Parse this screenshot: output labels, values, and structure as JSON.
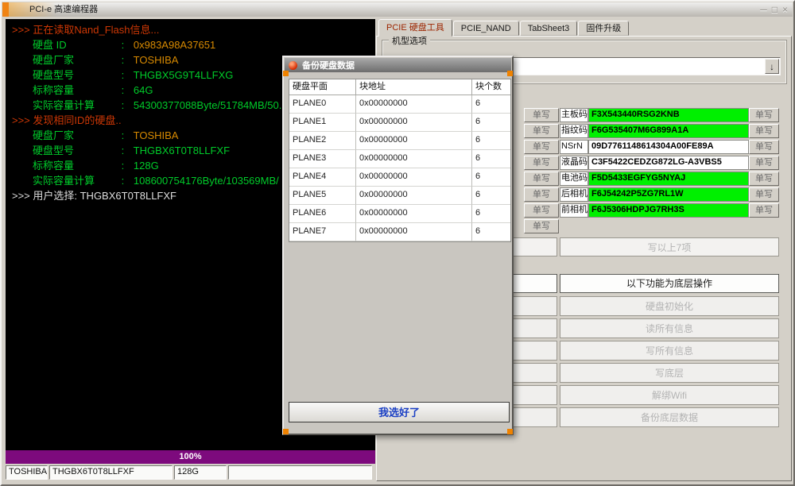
{
  "window": {
    "title": "PCI-e 高速编程器",
    "controls": {
      "minimize": "─",
      "maximize": "□",
      "close": "×"
    }
  },
  "colors": {
    "accent_orange": "#ef8200",
    "value_green": "#00f000",
    "progress_purple": "#7d0a7d"
  },
  "terminal": {
    "lines": [
      {
        "raw": ">>> 正在读取Nand_Flash信息...",
        "rawc": "t-red"
      },
      {
        "label": "硬盘 ID",
        "sep": ":",
        "value": "0x983A98A37651",
        "vc": "t-orange"
      },
      {
        "label": "硬盘厂家",
        "sep": ":",
        "value": "TOSHIBA",
        "vc": "t-orange"
      },
      {
        "label": "硬盘型号",
        "sep": ":",
        "value": "THGBX5G9T4LLFXG",
        "vc": "t-green"
      },
      {
        "label": "标称容量",
        "sep": ":",
        "value": "64G",
        "vc": "t-green"
      },
      {
        "label": "实际容量计算",
        "sep": ":",
        "value": "54300377088Byte/51784MB/50.",
        "vc": "t-green"
      },
      {
        "raw": ">>> 发现相同ID的硬盘..",
        "rawc": "t-red"
      },
      {
        "label": "硬盘厂家",
        "sep": ":",
        "value": "TOSHIBA",
        "vc": "t-orange"
      },
      {
        "label": "硬盘型号",
        "sep": ":",
        "value": "THGBX6T0T8LLFXF",
        "vc": "t-green"
      },
      {
        "label": "标称容量",
        "sep": ":",
        "value": "128G",
        "vc": "t-green"
      },
      {
        "label": "实际容量计算",
        "sep": ":",
        "value": "108600754176Byte/103569MB/",
        "vc": "t-green"
      },
      {
        "raw": ">>> 用户选择: THGBX6T0T8LLFXF",
        "rawc": "t-white"
      }
    ],
    "progress_text": "100%",
    "status_cells": [
      "TOSHIBA",
      "THGBX6T0T8LLFXF",
      "128G",
      ""
    ]
  },
  "tabs": [
    {
      "label": "PCIE 硬盘工具",
      "cls": "active"
    },
    {
      "label": "PCIE_NAND",
      "cls": ""
    },
    {
      "label": "TabSheet3",
      "cls": ""
    },
    {
      "label": "固件升级",
      "cls": ""
    }
  ],
  "model_group": {
    "title": "机型选项",
    "combo_value": "",
    "combo_arrow": "↓"
  },
  "fields": {
    "left_write_buttons": [
      "单写",
      "单写",
      "单写",
      "单写",
      "单写",
      "单写",
      "单写",
      "单写"
    ],
    "rows": [
      {
        "label": "主板码",
        "value": "F3X543440RSG2KNB",
        "vcls": "val-green",
        "btn": "单写"
      },
      {
        "label": "指纹码",
        "value": "F6G535407M6G899A1A",
        "vcls": "val-green",
        "btn": "单写"
      },
      {
        "label": "NSrN",
        "value": "09D7761148614304A00FE89A",
        "vcls": "",
        "btn": "单写"
      },
      {
        "label": "液晶码",
        "value": "C3F5422CEDZG872LG-A3VBS5",
        "vcls": "",
        "btn": "单写"
      },
      {
        "label": "电池码",
        "value": "F5D5433EGFYG5NYAJ",
        "vcls": "val-green",
        "btn": "单写"
      },
      {
        "label": "后相机",
        "value": "F6J54242P5ZG7RL1W",
        "vcls": "val-green",
        "btn": "单写"
      },
      {
        "label": "前相机",
        "value": "F6J5306HDPJG7RH3S",
        "vcls": "val-green",
        "btn": "单写"
      }
    ],
    "write_all_label": "写以上7项"
  },
  "lower_section": {
    "header": "以下功能为底层操作",
    "buttons": [
      "硬盘初始化",
      "读所有信息",
      "写所有信息",
      "写底层",
      "解绑Wifi",
      "备份底层数据"
    ]
  },
  "dialog": {
    "title": "备份硬盘数据",
    "table": {
      "headers": [
        "硬盘平面",
        "块地址",
        "块个数"
      ],
      "rows": [
        [
          "PLANE0",
          "0x00000000",
          "6"
        ],
        [
          "PLANE1",
          "0x00000000",
          "6"
        ],
        [
          "PLANE2",
          "0x00000000",
          "6"
        ],
        [
          "PLANE3",
          "0x00000000",
          "6"
        ],
        [
          "PLANE4",
          "0x00000000",
          "6"
        ],
        [
          "PLANE5",
          "0x00000000",
          "6"
        ],
        [
          "PLANE6",
          "0x00000000",
          "6"
        ],
        [
          "PLANE7",
          "0x00000000",
          "6"
        ]
      ]
    },
    "confirm_label": "我选好了"
  }
}
